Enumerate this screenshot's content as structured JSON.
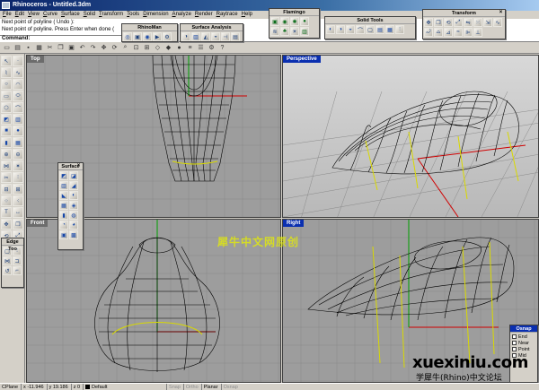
{
  "window": {
    "title": "Rhinoceros - Untitled.3dm"
  },
  "menu": [
    "File",
    "Edit",
    "View",
    "Curve",
    "Surface",
    "Solid",
    "Transform",
    "Tools",
    "Dimension",
    "Analyze",
    "Render",
    "Raytrace",
    "Help"
  ],
  "command": {
    "history": [
      "Next point of polyline ( Undo ):",
      "Next point of polyline. Press Enter when done ("
    ],
    "prompt": "Command:"
  },
  "toolbars": {
    "flamingo": "Flamingo",
    "solid_tools": "Solid Tools",
    "transform": "Transform",
    "rhinoman": "RhinoMan",
    "surface_analysis": "Surface Analysis",
    "surface": "Surface",
    "edge_tools": "Edge Too"
  },
  "viewports": {
    "top": "Top",
    "perspective": "Perspective",
    "front": "Front",
    "right": "Right"
  },
  "osnap": {
    "title": "Osnap",
    "items": [
      "End",
      "Near",
      "Point",
      "Mid"
    ]
  },
  "status": {
    "cplane": "CPlane",
    "x": "x -11.946",
    "y": "y 19.186",
    "z": "z 0",
    "layer": "Default",
    "snap": "Snap",
    "ortho": "Ortho",
    "planar": "Planar",
    "osnap": "Osnap"
  },
  "watermark": {
    "cn_banner": "犀牛中文网原创",
    "url": "xuexiniu.com",
    "sub": "学犀牛(Rhino)中文论坛"
  },
  "colors": {
    "active_tab": "#0a2fb0",
    "viewport_bg": "#9d9d9d",
    "perspective_bg_top": "#d8d8d8",
    "wire": "#000000",
    "axis_x": "#d00000",
    "axis_y": "#00a000",
    "yellow_curve": "#d9d900"
  }
}
